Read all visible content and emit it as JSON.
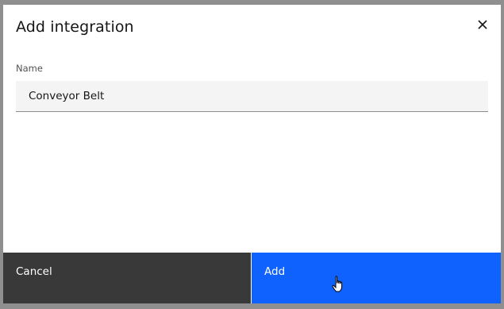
{
  "modal": {
    "title": "Add integration",
    "close_icon": "close-icon"
  },
  "form": {
    "name_label": "Name",
    "name_value": "Conveyor Belt"
  },
  "footer": {
    "cancel_label": "Cancel",
    "add_label": "Add"
  },
  "colors": {
    "primary": "#0f62fe",
    "secondary": "#393939",
    "field_bg": "#f4f4f4"
  }
}
